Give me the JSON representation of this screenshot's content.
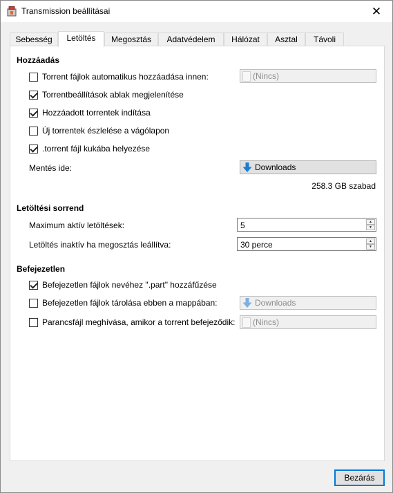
{
  "window": {
    "title": "Transmission beállításai",
    "close_glyph": "✕"
  },
  "tabs": [
    {
      "label": "Sebesség"
    },
    {
      "label": "Letöltés",
      "active": true
    },
    {
      "label": "Megosztás"
    },
    {
      "label": "Adatvédelem"
    },
    {
      "label": "Hálózat"
    },
    {
      "label": "Asztal"
    },
    {
      "label": "Távoli"
    }
  ],
  "adding": {
    "title": "Hozzáadás",
    "auto_add": {
      "label": "Torrent fájlok automatikus hozzáadása innen:",
      "checked": false,
      "chooser": "(Nincs)"
    },
    "show_options": {
      "label": "Torrentbeállítások ablak megjelenítése",
      "checked": true
    },
    "start_added": {
      "label": "Hozzáadott torrentek indítása",
      "checked": true
    },
    "detect_clipboard": {
      "label": "Új torrentek észlelése a vágólapon",
      "checked": false
    },
    "trash_torrent": {
      "label": ".torrent fájl kukába helyezése",
      "checked": true
    },
    "save_to": {
      "label": "Mentés ide:",
      "chooser": "Downloads"
    },
    "free_space": "258.3 GB szabad"
  },
  "queue": {
    "title": "Letöltési sorrend",
    "max_active": {
      "label": "Maximum aktív letöltések:",
      "value": "5"
    },
    "stalled": {
      "label": "Letöltés inaktív ha megosztás leállítva:",
      "value": "30 perce"
    }
  },
  "incomplete": {
    "title": "Befejezetlen",
    "append_part": {
      "label": "Befejezetlen fájlok nevéhez \".part\" hozzáfűzése",
      "checked": true
    },
    "keep_in_folder": {
      "label": "Befejezetlen fájlok tárolása ebben a mappában:",
      "checked": false,
      "chooser": "Downloads"
    },
    "call_script": {
      "label": "Parancsfájl meghívása, amikor a torrent befejeződik:",
      "checked": false,
      "chooser": "(Nincs)"
    }
  },
  "footer": {
    "close_label": "Bezárás"
  },
  "colors": {
    "accent": "#0078d7",
    "folder_arrow": "#1c7cd5"
  },
  "icons": {
    "app": "transmission-icon",
    "folder": "folder-download-icon",
    "file": "file-icon"
  }
}
